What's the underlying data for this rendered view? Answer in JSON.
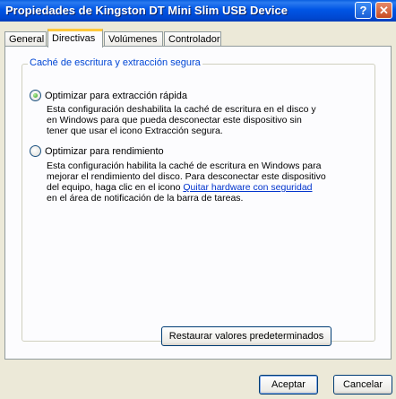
{
  "window": {
    "title": "Propiedades de Kingston DT Mini Slim USB Device",
    "help_glyph": "?",
    "close_glyph": "✕"
  },
  "tabs": [
    {
      "label": "General",
      "active": false
    },
    {
      "label": "Directivas",
      "active": true
    },
    {
      "label": "Volúmenes",
      "active": false
    },
    {
      "label": "Controlador",
      "active": false
    }
  ],
  "group": {
    "title": "Caché de escritura y extracción segura"
  },
  "options": [
    {
      "label": "Optimizar para extracción rápida",
      "checked": true,
      "description_lines": [
        "Esta configuración deshabilita la caché de escritura en el disco y",
        "en Windows para que pueda desconectar este dispositivo sin",
        "tener que usar el icono Extracción segura."
      ]
    },
    {
      "label": "Optimizar para rendimiento",
      "checked": false,
      "description_lines": [
        "Esta configuración habilita la caché de escritura en Windows para",
        "mejorar el rendimiento del disco. Para desconectar este dispositivo",
        "del equipo, haga clic en el icono "
      ],
      "link_text": "Quitar hardware con seguridad",
      "description_end": "en el área de notificación de la barra de tareas."
    }
  ],
  "buttons": {
    "restore": "Restaurar valores predeterminados",
    "ok": "Aceptar",
    "cancel": "Cancelar"
  }
}
